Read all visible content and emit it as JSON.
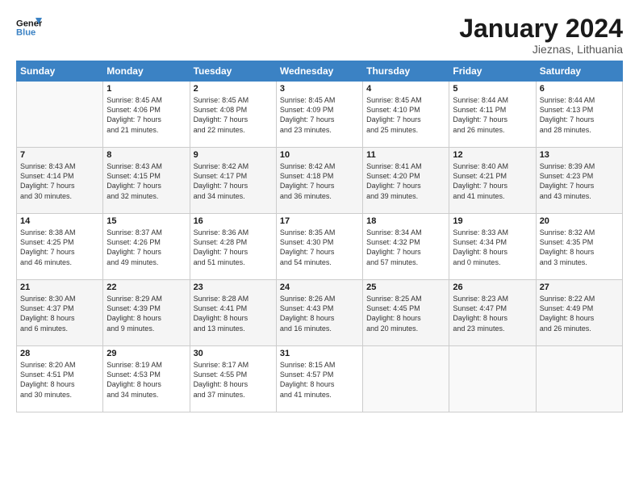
{
  "header": {
    "logo_line1": "General",
    "logo_line2": "Blue",
    "month_title": "January 2024",
    "location": "Jieznas, Lithuania"
  },
  "days_of_week": [
    "Sunday",
    "Monday",
    "Tuesday",
    "Wednesday",
    "Thursday",
    "Friday",
    "Saturday"
  ],
  "weeks": [
    [
      {
        "day": "",
        "info": ""
      },
      {
        "day": "1",
        "info": "Sunrise: 8:45 AM\nSunset: 4:06 PM\nDaylight: 7 hours\nand 21 minutes."
      },
      {
        "day": "2",
        "info": "Sunrise: 8:45 AM\nSunset: 4:08 PM\nDaylight: 7 hours\nand 22 minutes."
      },
      {
        "day": "3",
        "info": "Sunrise: 8:45 AM\nSunset: 4:09 PM\nDaylight: 7 hours\nand 23 minutes."
      },
      {
        "day": "4",
        "info": "Sunrise: 8:45 AM\nSunset: 4:10 PM\nDaylight: 7 hours\nand 25 minutes."
      },
      {
        "day": "5",
        "info": "Sunrise: 8:44 AM\nSunset: 4:11 PM\nDaylight: 7 hours\nand 26 minutes."
      },
      {
        "day": "6",
        "info": "Sunrise: 8:44 AM\nSunset: 4:13 PM\nDaylight: 7 hours\nand 28 minutes."
      }
    ],
    [
      {
        "day": "7",
        "info": "Sunrise: 8:43 AM\nSunset: 4:14 PM\nDaylight: 7 hours\nand 30 minutes."
      },
      {
        "day": "8",
        "info": "Sunrise: 8:43 AM\nSunset: 4:15 PM\nDaylight: 7 hours\nand 32 minutes."
      },
      {
        "day": "9",
        "info": "Sunrise: 8:42 AM\nSunset: 4:17 PM\nDaylight: 7 hours\nand 34 minutes."
      },
      {
        "day": "10",
        "info": "Sunrise: 8:42 AM\nSunset: 4:18 PM\nDaylight: 7 hours\nand 36 minutes."
      },
      {
        "day": "11",
        "info": "Sunrise: 8:41 AM\nSunset: 4:20 PM\nDaylight: 7 hours\nand 39 minutes."
      },
      {
        "day": "12",
        "info": "Sunrise: 8:40 AM\nSunset: 4:21 PM\nDaylight: 7 hours\nand 41 minutes."
      },
      {
        "day": "13",
        "info": "Sunrise: 8:39 AM\nSunset: 4:23 PM\nDaylight: 7 hours\nand 43 minutes."
      }
    ],
    [
      {
        "day": "14",
        "info": "Sunrise: 8:38 AM\nSunset: 4:25 PM\nDaylight: 7 hours\nand 46 minutes."
      },
      {
        "day": "15",
        "info": "Sunrise: 8:37 AM\nSunset: 4:26 PM\nDaylight: 7 hours\nand 49 minutes."
      },
      {
        "day": "16",
        "info": "Sunrise: 8:36 AM\nSunset: 4:28 PM\nDaylight: 7 hours\nand 51 minutes."
      },
      {
        "day": "17",
        "info": "Sunrise: 8:35 AM\nSunset: 4:30 PM\nDaylight: 7 hours\nand 54 minutes."
      },
      {
        "day": "18",
        "info": "Sunrise: 8:34 AM\nSunset: 4:32 PM\nDaylight: 7 hours\nand 57 minutes."
      },
      {
        "day": "19",
        "info": "Sunrise: 8:33 AM\nSunset: 4:34 PM\nDaylight: 8 hours\nand 0 minutes."
      },
      {
        "day": "20",
        "info": "Sunrise: 8:32 AM\nSunset: 4:35 PM\nDaylight: 8 hours\nand 3 minutes."
      }
    ],
    [
      {
        "day": "21",
        "info": "Sunrise: 8:30 AM\nSunset: 4:37 PM\nDaylight: 8 hours\nand 6 minutes."
      },
      {
        "day": "22",
        "info": "Sunrise: 8:29 AM\nSunset: 4:39 PM\nDaylight: 8 hours\nand 9 minutes."
      },
      {
        "day": "23",
        "info": "Sunrise: 8:28 AM\nSunset: 4:41 PM\nDaylight: 8 hours\nand 13 minutes."
      },
      {
        "day": "24",
        "info": "Sunrise: 8:26 AM\nSunset: 4:43 PM\nDaylight: 8 hours\nand 16 minutes."
      },
      {
        "day": "25",
        "info": "Sunrise: 8:25 AM\nSunset: 4:45 PM\nDaylight: 8 hours\nand 20 minutes."
      },
      {
        "day": "26",
        "info": "Sunrise: 8:23 AM\nSunset: 4:47 PM\nDaylight: 8 hours\nand 23 minutes."
      },
      {
        "day": "27",
        "info": "Sunrise: 8:22 AM\nSunset: 4:49 PM\nDaylight: 8 hours\nand 26 minutes."
      }
    ],
    [
      {
        "day": "28",
        "info": "Sunrise: 8:20 AM\nSunset: 4:51 PM\nDaylight: 8 hours\nand 30 minutes."
      },
      {
        "day": "29",
        "info": "Sunrise: 8:19 AM\nSunset: 4:53 PM\nDaylight: 8 hours\nand 34 minutes."
      },
      {
        "day": "30",
        "info": "Sunrise: 8:17 AM\nSunset: 4:55 PM\nDaylight: 8 hours\nand 37 minutes."
      },
      {
        "day": "31",
        "info": "Sunrise: 8:15 AM\nSunset: 4:57 PM\nDaylight: 8 hours\nand 41 minutes."
      },
      {
        "day": "",
        "info": ""
      },
      {
        "day": "",
        "info": ""
      },
      {
        "day": "",
        "info": ""
      }
    ]
  ]
}
